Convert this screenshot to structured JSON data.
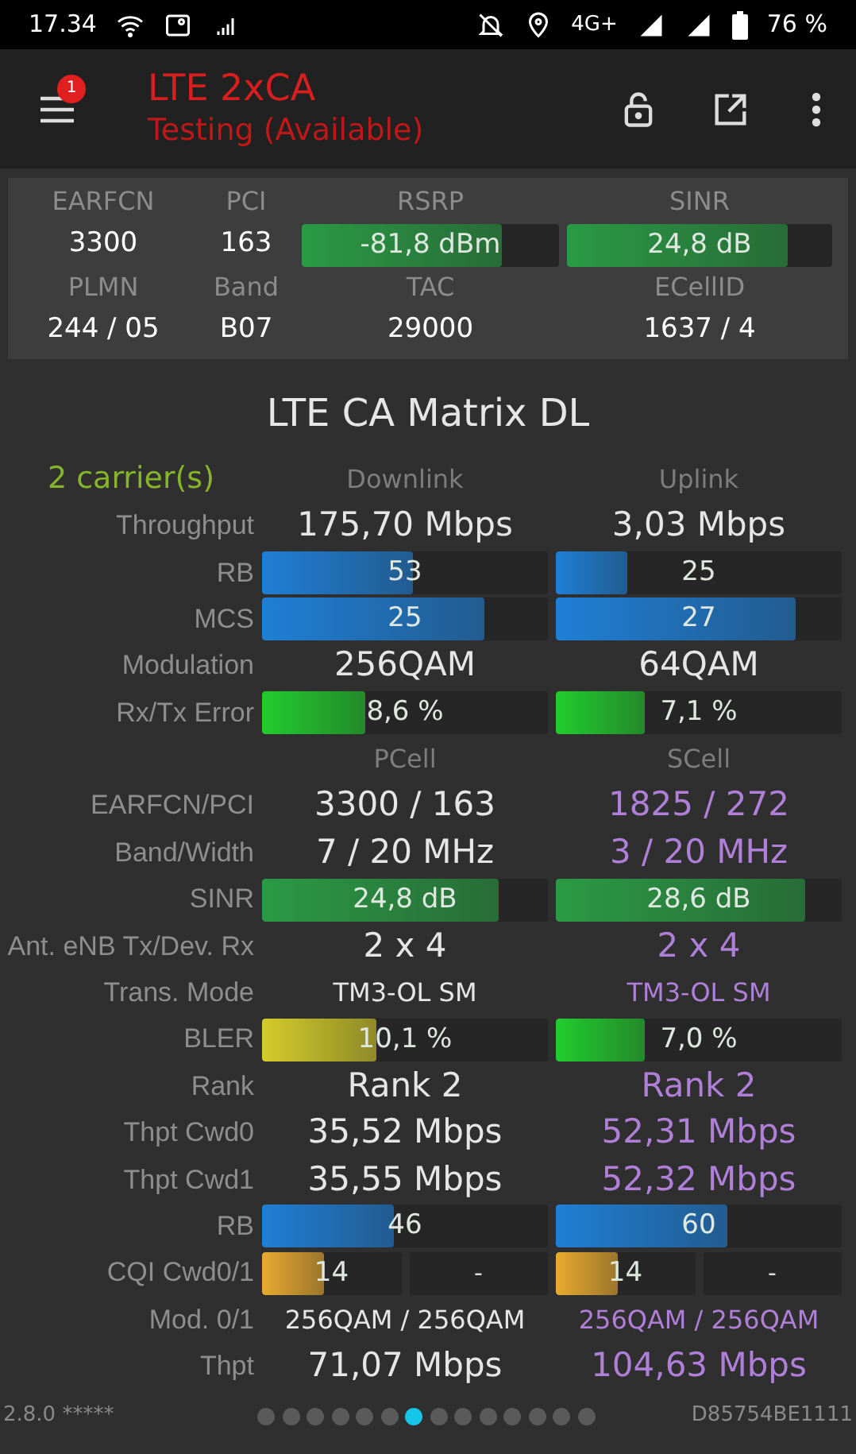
{
  "status_bar": {
    "time": "17.34",
    "network": "4G+",
    "battery": "76 %"
  },
  "app_bar": {
    "title": "LTE 2xCA",
    "subtitle": "Testing (Available)",
    "badge": "1"
  },
  "summary": {
    "rows": [
      {
        "labels": [
          "EARFCN",
          "PCI",
          "RSRP",
          "SINR"
        ],
        "cells": [
          {
            "kind": "text",
            "text": "3300"
          },
          {
            "kind": "text",
            "text": "163"
          },
          {
            "kind": "bar",
            "text": "-81,8 dBm",
            "level": 0.78,
            "color": "#2a9a44"
          },
          {
            "kind": "bar",
            "text": "24,8 dB",
            "level": 0.83,
            "color": "#2a9a44"
          }
        ]
      },
      {
        "labels": [
          "PLMN",
          "Band",
          "TAC",
          "ECellID"
        ],
        "cells": [
          {
            "kind": "text",
            "text": "244 / 05"
          },
          {
            "kind": "text",
            "text": "B07"
          },
          {
            "kind": "text",
            "text": "29000"
          },
          {
            "kind": "text",
            "text": "1637 / 4"
          }
        ]
      }
    ]
  },
  "matrix": {
    "title": "LTE CA Matrix DL",
    "rows": [
      {
        "kind": "header",
        "label": "2 carrier(s)",
        "cells": [
          {
            "text": "Downlink"
          },
          {
            "text": "Uplink"
          }
        ]
      },
      {
        "kind": "data",
        "label": "Throughput",
        "cells": [
          {
            "kind": "text",
            "text": "175,70 Mbps",
            "highlighted": false
          },
          {
            "kind": "text",
            "text": "3,03 Mbps",
            "highlighted": false
          }
        ]
      },
      {
        "kind": "data",
        "label": "RB",
        "cells": [
          {
            "kind": "bar",
            "text": "53",
            "level": 0.53,
            "color": "#1f7fd6"
          },
          {
            "kind": "bar",
            "text": "25",
            "level": 0.25,
            "color": "#1f7fd6"
          }
        ]
      },
      {
        "kind": "data",
        "label": "MCS",
        "cells": [
          {
            "kind": "bar",
            "text": "25",
            "level": 0.78,
            "color": "#1f7fd6"
          },
          {
            "kind": "bar",
            "text": "27",
            "level": 0.84,
            "color": "#1f7fd6"
          }
        ]
      },
      {
        "kind": "data",
        "label": "Modulation",
        "cells": [
          {
            "kind": "text",
            "text": "256QAM",
            "highlighted": false
          },
          {
            "kind": "text",
            "text": "64QAM",
            "highlighted": false
          }
        ]
      },
      {
        "kind": "data",
        "label": "Rx/Tx Error",
        "cells": [
          {
            "kind": "bar",
            "text": "8,6 %",
            "level": 0.36,
            "color": "#22cc2e"
          },
          {
            "kind": "bar",
            "text": "7,1 %",
            "level": 0.31,
            "color": "#22cc2e"
          }
        ]
      },
      {
        "kind": "header",
        "cells": [
          {
            "text": "PCell"
          },
          {
            "text": "SCell"
          }
        ]
      },
      {
        "kind": "data",
        "label": "EARFCN/PCI",
        "cells": [
          {
            "kind": "text",
            "text": "3300 / 163",
            "highlighted": false
          },
          {
            "kind": "text",
            "text": "1825 / 272",
            "highlighted": true
          }
        ]
      },
      {
        "kind": "data",
        "label": "Band/Width",
        "cells": [
          {
            "kind": "text",
            "text": "7 / 20 MHz",
            "highlighted": false
          },
          {
            "kind": "text",
            "text": "3 / 20 MHz",
            "highlighted": true
          }
        ]
      },
      {
        "kind": "data",
        "label": "SINR",
        "cells": [
          {
            "kind": "bar",
            "text": "24,8 dB",
            "level": 0.83,
            "color": "#2a9a44"
          },
          {
            "kind": "bar",
            "text": "28,6 dB",
            "level": 0.87,
            "color": "#2a9a44"
          }
        ]
      },
      {
        "kind": "data",
        "label": "Ant. eNB Tx/Dev. Rx",
        "cells": [
          {
            "kind": "text",
            "text": "2 x 4",
            "highlighted": false
          },
          {
            "kind": "text",
            "text": "2 x 4",
            "highlighted": true
          }
        ]
      },
      {
        "kind": "data",
        "label": "Trans. Mode",
        "cells": [
          {
            "kind": "small_text",
            "text": "TM3-OL SM",
            "highlighted": false
          },
          {
            "kind": "small_text",
            "text": "TM3-OL SM",
            "highlighted": true
          }
        ]
      },
      {
        "kind": "data",
        "label": "BLER",
        "cells": [
          {
            "kind": "bar",
            "text": "10,1 %",
            "level": 0.4,
            "color": "#d4cc2a"
          },
          {
            "kind": "bar",
            "text": "7,0 %",
            "level": 0.31,
            "color": "#22cc2e"
          }
        ]
      },
      {
        "kind": "data",
        "label": "Rank",
        "cells": [
          {
            "kind": "text",
            "text": "Rank 2",
            "highlighted": false
          },
          {
            "kind": "text",
            "text": "Rank 2",
            "highlighted": true
          }
        ]
      },
      {
        "kind": "data",
        "label": "Thpt Cwd0",
        "cells": [
          {
            "kind": "text",
            "text": "35,52 Mbps",
            "highlighted": false
          },
          {
            "kind": "text",
            "text": "52,31 Mbps",
            "highlighted": true
          }
        ]
      },
      {
        "kind": "data",
        "label": "Thpt Cwd1",
        "cells": [
          {
            "kind": "text",
            "text": "35,55 Mbps",
            "highlighted": false
          },
          {
            "kind": "text",
            "text": "52,32 Mbps",
            "highlighted": true
          }
        ]
      },
      {
        "kind": "data",
        "label": "RB",
        "cells": [
          {
            "kind": "bar",
            "text": "46",
            "level": 0.46,
            "color": "#1f7fd6"
          },
          {
            "kind": "bar",
            "text": "60",
            "level": 0.6,
            "color": "#1f7fd6"
          }
        ]
      },
      {
        "kind": "data",
        "label": "CQI Cwd0/1",
        "cells": [
          {
            "kind": "split_bar",
            "text": "14",
            "level": 0.44,
            "color": "#e8aa30",
            "second_text": "-"
          },
          {
            "kind": "split_bar",
            "text": "14",
            "level": 0.44,
            "color": "#e8aa30",
            "second_text": "-"
          }
        ]
      },
      {
        "kind": "data",
        "label": "Mod. 0/1",
        "cells": [
          {
            "kind": "small_text",
            "text": "256QAM / 256QAM",
            "highlighted": false
          },
          {
            "kind": "small_text",
            "text": "256QAM / 256QAM",
            "highlighted": true
          }
        ]
      },
      {
        "kind": "data",
        "label": "Thpt",
        "cells": [
          {
            "kind": "text",
            "text": "71,07 Mbps",
            "highlighted": false
          },
          {
            "kind": "text",
            "text": "104,63 Mbps",
            "highlighted": true
          }
        ]
      }
    ]
  },
  "footer": {
    "version": "2.8.0 *****",
    "device_id": "D85754BE1111",
    "pages": [
      {
        "selected": false
      },
      {
        "selected": false
      },
      {
        "selected": false
      },
      {
        "selected": false
      },
      {
        "selected": false
      },
      {
        "selected": false
      },
      {
        "selected": true
      },
      {
        "selected": false
      },
      {
        "selected": false
      },
      {
        "selected": false
      },
      {
        "selected": false
      },
      {
        "selected": false
      },
      {
        "selected": false
      },
      {
        "selected": false
      }
    ]
  }
}
